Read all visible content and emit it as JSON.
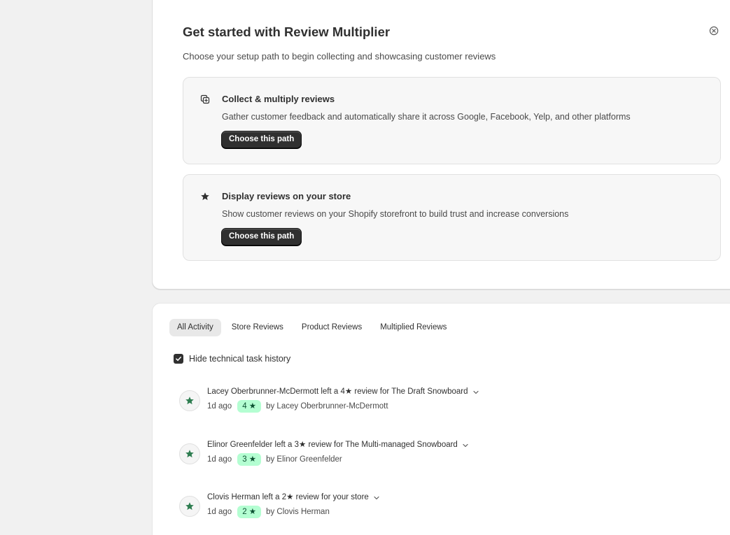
{
  "setup": {
    "title": "Get started with Review Multiplier",
    "subtitle": "Choose your setup path to begin collecting and showcasing customer reviews",
    "paths": [
      {
        "icon": "duplicate-icon",
        "title": "Collect & multiply reviews",
        "description": "Gather customer feedback and automatically share it across Google, Facebook, Yelp, and other platforms",
        "button_label": "Choose this path"
      },
      {
        "icon": "star-icon",
        "title": "Display reviews on your store",
        "description": "Show customer reviews on your Shopify storefront to build trust and increase conversions",
        "button_label": "Choose this path"
      }
    ]
  },
  "activity": {
    "tabs": [
      {
        "label": "All Activity",
        "active": true
      },
      {
        "label": "Store Reviews",
        "active": false
      },
      {
        "label": "Product Reviews",
        "active": false
      },
      {
        "label": "Multiplied Reviews",
        "active": false
      }
    ],
    "hide_technical": {
      "label": "Hide technical task history",
      "checked": true
    },
    "items": [
      {
        "title": "Lacey Oberbrunner-McDermott left a 4★ review for The Draft Snowboard",
        "time": "1d ago",
        "rating": "4 ★",
        "byline": "by Lacey Oberbrunner-McDermott"
      },
      {
        "title": "Elinor Greenfelder left a 3★ review for The Multi-managed Snowboard",
        "time": "1d ago",
        "rating": "3 ★",
        "byline": "by Elinor Greenfelder"
      },
      {
        "title": "Clovis Herman left a 2★ review for your store",
        "time": "1d ago",
        "rating": "2 ★",
        "byline": "by Clovis Herman"
      }
    ]
  },
  "colors": {
    "badge_bg": "#b4fed2",
    "badge_text": "#0c5132",
    "star_green": "#2e7d50",
    "button_dark": "#303030"
  }
}
